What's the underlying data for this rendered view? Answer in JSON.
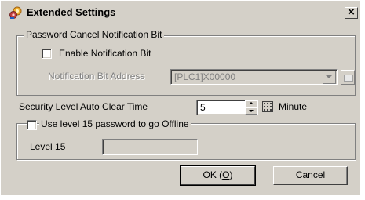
{
  "window": {
    "title": "Extended Settings",
    "close_label": "×"
  },
  "password_group": {
    "legend": "Password Cancel Notification Bit",
    "enable_label": "Enable Notification Bit",
    "enable_checked": false,
    "address_label": "Notification Bit Address",
    "address_value": "[PLC1]X00000"
  },
  "security": {
    "label": "Security Level Auto Clear Time",
    "value": "5",
    "unit": "Minute"
  },
  "offline_group": {
    "legend": "Use level 15 password to go Offline",
    "checked": false,
    "level_label": "Level 15",
    "level_value": ""
  },
  "buttons": {
    "ok_label": "OK (",
    "ok_mnemonic": "O",
    "ok_suffix": ")",
    "cancel_label": "Cancel"
  },
  "icons": {
    "title": "settings-gear-icon",
    "dropdown": "chevron-down-icon",
    "address_picker": "keypad-icon",
    "spin": "spinner-icon",
    "keypad": "calculator-icon"
  }
}
